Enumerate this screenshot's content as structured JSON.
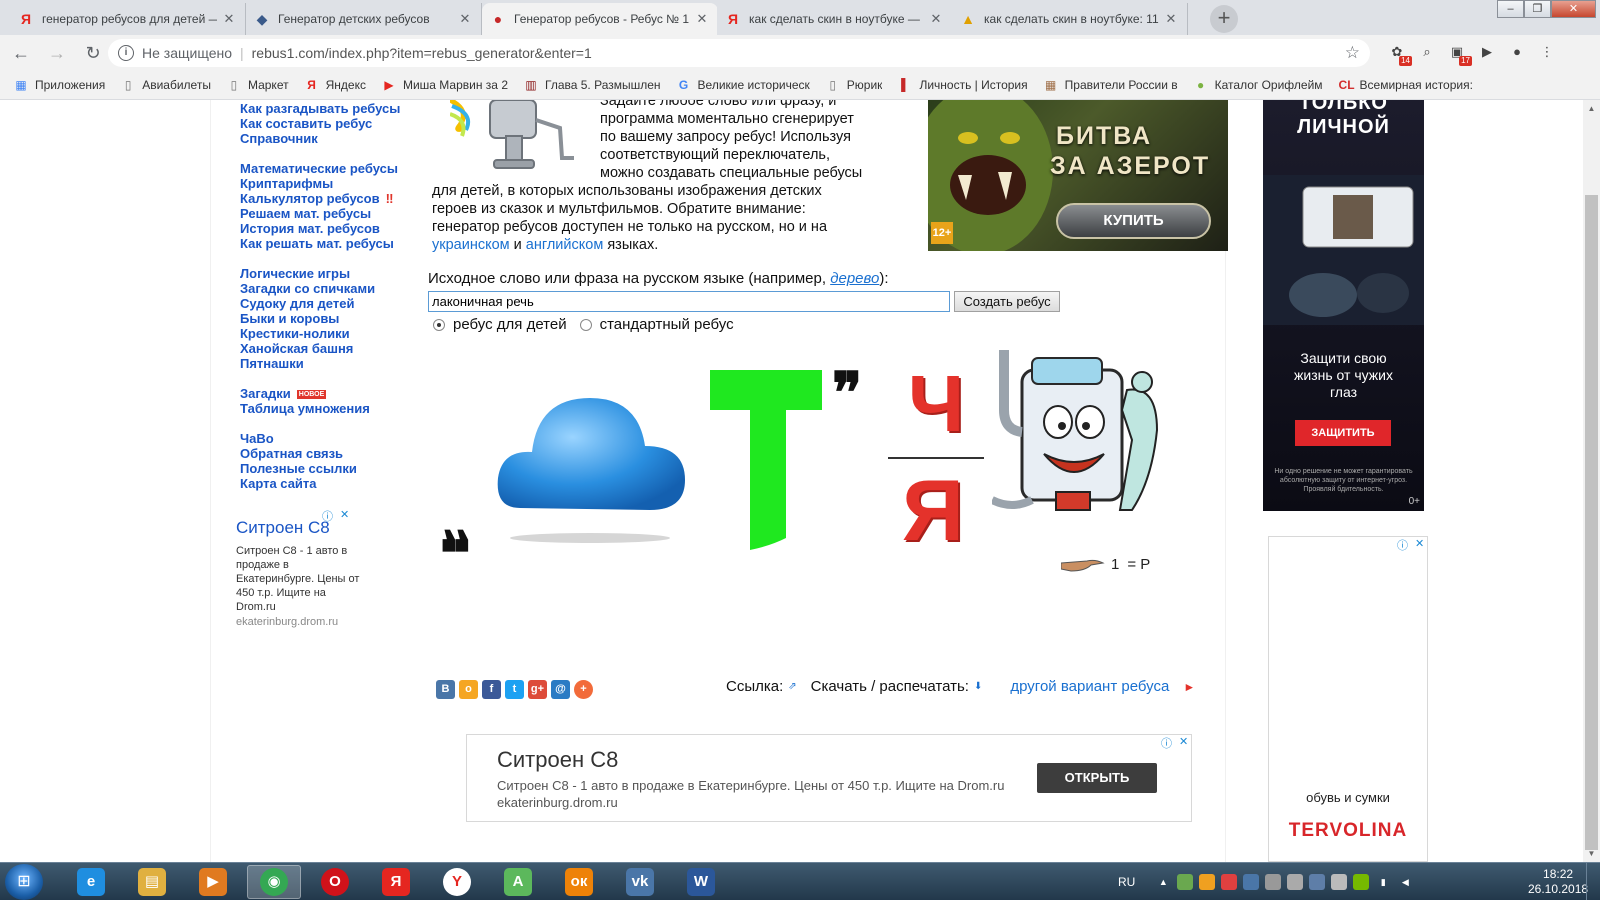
{
  "tabs": [
    {
      "title": "генератор ребусов для детей —",
      "fav": "Я",
      "fav_color": "#e52620"
    },
    {
      "title": "Генератор детских ребусов",
      "fav": "◆",
      "fav_color": "#3a5a8a"
    },
    {
      "title": "Генератор ребусов - Ребус № 1",
      "fav": "●",
      "fav_color": "#c62828",
      "active": true
    },
    {
      "title": "как сделать скин в ноутбуке —",
      "fav": "Я",
      "fav_color": "#e52620"
    },
    {
      "title": "как сделать скин в ноутбуке: 11",
      "fav": "▲",
      "fav_color": "#e0a000"
    }
  ],
  "new_tab": "+",
  "window_buttons": {
    "minimize": "–",
    "maximize": "❐",
    "close": "✕"
  },
  "omnibox": {
    "security": "Не защищено",
    "url": "rebus1.com/index.php?item=rebus_generator&enter=1"
  },
  "extensions": [
    {
      "glyph": "✿",
      "badge": "14"
    },
    {
      "glyph": "⌕",
      "badge": ""
    },
    {
      "glyph": "▣",
      "badge": "17"
    },
    {
      "glyph": "▶",
      "badge": ""
    },
    {
      "glyph": "●",
      "badge": ""
    },
    {
      "glyph": "⋮",
      "badge": ""
    }
  ],
  "bookmarks": [
    {
      "label": "Приложения",
      "icon": "▦",
      "color": "#4285f4"
    },
    {
      "label": "Авиабилеты",
      "icon": "▯",
      "color": "#777"
    },
    {
      "label": "Маркет",
      "icon": "▯",
      "color": "#777"
    },
    {
      "label": "Яндекс",
      "icon": "Я",
      "color": "#e52620"
    },
    {
      "label": "Миша Марвин за 2",
      "icon": "▶",
      "color": "#e52620"
    },
    {
      "label": "Глава 5. Размышлен",
      "icon": "▥",
      "color": "#8b1a1a"
    },
    {
      "label": "Великие историческ",
      "icon": "G",
      "color": "#4285f4"
    },
    {
      "label": "Рюрик",
      "icon": "▯",
      "color": "#777"
    },
    {
      "label": "Личность | История",
      "icon": "▌",
      "color": "#c62828"
    },
    {
      "label": "Правители России в",
      "icon": "▦",
      "color": "#a0704a"
    },
    {
      "label": "Каталог Орифлейм",
      "icon": "●",
      "color": "#7cb342"
    },
    {
      "label": "Всемирная история:",
      "icon": "CL",
      "color": "#d32f2f"
    }
  ],
  "nav_groups": [
    [
      "Как разгадывать ребусы",
      "Как составить ребус",
      "Справочник"
    ],
    [
      "Математические ребусы",
      "Криптарифмы",
      "Калькулятор ребусов",
      "Решаем мат. ребусы",
      "История мат. ребусов",
      "Как решать мат. ребусы"
    ],
    [
      "Логические игры",
      "Загадки со спичками",
      "Судоку для детей",
      "Быки и коровы",
      "Крестики-нолики",
      "Ханойская башня",
      "Пятнашки"
    ],
    [
      "Загадки",
      "Таблица умножения"
    ],
    [
      "ЧаВо",
      "Обратная связь",
      "Полезные ссылки",
      "Карта сайта"
    ]
  ],
  "nav_marks": {
    "calc_excl": "‼",
    "new_badge": "НОВОЕ"
  },
  "description": {
    "l1": "Задайте любое слово или фразу, и",
    "l2": "программа моментально сгенерирует",
    "l3": "по вашему запросу ребус! Используя",
    "l4": "соответствующий переключатель,",
    "l5": "можно создавать специальные ребусы",
    "l6": "для детей, в которых использованы изображения детских",
    "l7": "героев из сказок и мультфильмов. Обратите внимание:",
    "l8": "генератор ребусов доступен не только на русском, но и на",
    "link_ua": "украинском",
    "and": " и ",
    "link_en": "английском",
    "tail": " языках."
  },
  "game_ad": {
    "line1": "БИТВА",
    "line2": "ЗА АЗЕРОТ",
    "button": "КУПИТЬ",
    "age": "12+"
  },
  "form": {
    "label_prefix": "Исходное слово или фраза на русском языке (например, ",
    "label_example": "дерево",
    "label_suffix": "):",
    "input_value": "лаконичная речь",
    "button": "Создать ребус",
    "radio_kids": "ребус для детей",
    "radio_std": "стандартный ребус",
    "selected": "kids"
  },
  "rebus": {
    "comma": "❞",
    "quote": "❞",
    "num": "Ч",
    "den": "Я",
    "hint_num": "1",
    "hint_eq": "= Р"
  },
  "share_buttons": [
    {
      "label": "В",
      "color": "#4a76a8"
    },
    {
      "label": "о",
      "color": "#f5a623"
    },
    {
      "label": "f",
      "color": "#3b5998"
    },
    {
      "label": "t",
      "color": "#1da1f2"
    },
    {
      "label": "g+",
      "color": "#dd4b39"
    },
    {
      "label": "@",
      "color": "#2a7bc4"
    },
    {
      "label": "+",
      "color": "#f26b3a"
    }
  ],
  "links": {
    "link": "Ссылка:",
    "link_icon": "⇗",
    "download": "Скачать / распечатать:",
    "download_icon": "⬇",
    "variant": "другой вариант ребуса",
    "variant_arrow": "►"
  },
  "left_ad": {
    "title": "Ситроен С8",
    "body": "Ситроен С8 - 1 авто в продаже в Екатеринбурге. Цены от 450 т.р. Ищите на Drom.ru",
    "domain": "ekaterinburg.drom.ru",
    "adchoice": "ⓘ",
    "close": "✕"
  },
  "bottom_ad": {
    "title": "Ситроен С8",
    "body": "Ситроен С8 - 1 авто в продаже в Екатеринбурге. Цены от 450 т.р. Ищите на Drom.ru",
    "domain": "ekaterinburg.drom.ru",
    "button": "ОТКРЫТЬ"
  },
  "right_ad1": {
    "top1": "ТОЛЬКО",
    "top2": "ЛИЧНОЙ",
    "mid": "Защити свою жизнь от чужих глаз",
    "button": "ЗАЩИТИТЬ",
    "fine": "Ни одно решение не может гарантировать абсолютную защиту от интернет-угроз. Проявляй бдительность.",
    "age": "0+"
  },
  "right_ad2": {
    "text": "обувь и сумки",
    "brand": "TERVOLINA"
  },
  "taskbar": {
    "apps": [
      {
        "name": "ie",
        "glyph": "e",
        "color": "#1f8ee0"
      },
      {
        "name": "explorer",
        "glyph": "▤",
        "color": "#e0b040"
      },
      {
        "name": "media",
        "glyph": "▶",
        "color": "#e07a20"
      },
      {
        "name": "chrome",
        "glyph": "◉",
        "color": "#34a853",
        "active": true
      },
      {
        "name": "opera",
        "glyph": "O",
        "color": "#d0121a"
      },
      {
        "name": "yandex-browser",
        "glyph": "Я",
        "color": "#e52620"
      },
      {
        "name": "yandex",
        "glyph": "Y",
        "color": "#ffffff",
        "fg": "#e52620"
      },
      {
        "name": "torrent",
        "glyph": "A",
        "color": "#5cb85c"
      },
      {
        "name": "odnoklassniki",
        "glyph": "ок",
        "color": "#ee8208"
      },
      {
        "name": "vk",
        "glyph": "vk",
        "color": "#4a76a8"
      },
      {
        "name": "word",
        "glyph": "W",
        "color": "#2b579a"
      }
    ],
    "lang": "RU",
    "time": "18:22",
    "date": "26.10.2018"
  }
}
